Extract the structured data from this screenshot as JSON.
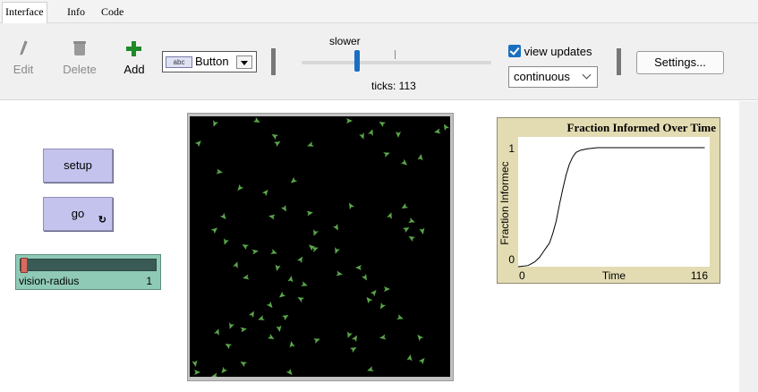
{
  "tabs": [
    "Interface",
    "Info",
    "Code"
  ],
  "toolbar": {
    "edit_label": "Edit",
    "delete_label": "Delete",
    "add_label": "Add",
    "widget_type": "Button",
    "widget_type_icon_text": "abc",
    "speed_label": "slower",
    "ticks_label": "ticks: 113",
    "view_updates_label": "view updates",
    "view_updates_checked": true,
    "update_mode": "continuous",
    "settings_label": "Settings..."
  },
  "widgets": {
    "setup_label": "setup",
    "go_label": "go",
    "slider": {
      "name": "vision-radius",
      "value": "1",
      "level": 0.0
    }
  },
  "colors": {
    "button": "#c3c3ee",
    "slider": "#8fcab7",
    "plot_bg": "#e3dcb3",
    "turtle": "#5aa84a",
    "add_icon": "#1e8a2a",
    "accent": "#1a6fc0"
  },
  "chart_data": {
    "type": "line",
    "title": "Fraction Informed Over Time",
    "xlabel": "Time",
    "ylabel": "Fraction Informec",
    "xlim": [
      0,
      116
    ],
    "ylim": [
      0,
      1
    ],
    "x_ticks": [
      "0",
      "116"
    ],
    "y_ticks": [
      "0",
      "1"
    ],
    "series": [
      {
        "name": "",
        "x": [
          0,
          6,
          10,
          13,
          15,
          17,
          19,
          21,
          23,
          25,
          27,
          29,
          31,
          33,
          35,
          38,
          42,
          48,
          56,
          70,
          90,
          113
        ],
        "y": [
          0.0,
          0.01,
          0.04,
          0.08,
          0.12,
          0.16,
          0.2,
          0.28,
          0.38,
          0.52,
          0.65,
          0.77,
          0.86,
          0.92,
          0.96,
          0.98,
          0.99,
          1.0,
          1.0,
          1.0,
          1.0,
          1.0
        ]
      }
    ]
  }
}
